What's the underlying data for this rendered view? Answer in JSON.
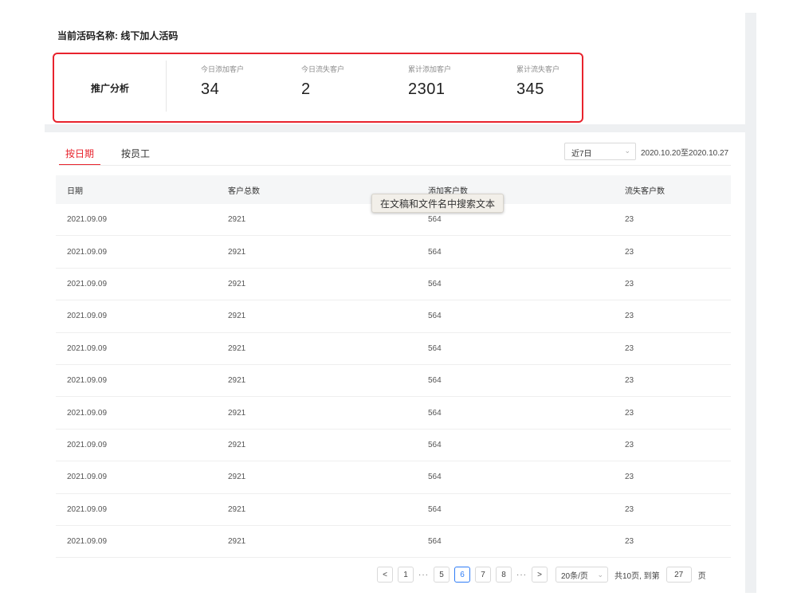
{
  "header": {
    "title": "当前活码名称: 线下加人活码"
  },
  "stats": {
    "section_label": "推广分析",
    "items": [
      {
        "label": "今日添加客户",
        "value": "34"
      },
      {
        "label": "今日流失客户",
        "value": "2"
      },
      {
        "label": "累计添加客户",
        "value": "2301"
      },
      {
        "label": "累计流失客户",
        "value": "345"
      }
    ]
  },
  "tabs": [
    {
      "label": "按日期",
      "active": true
    },
    {
      "label": "按员工",
      "active": false
    }
  ],
  "filter": {
    "period": "近7日",
    "date_range": "2020.10.20至2020.10.27"
  },
  "table": {
    "columns": [
      "日期",
      "客户总数",
      "添加客户数",
      "流失客户数"
    ],
    "rows": [
      [
        "2021.09.09",
        "2921",
        "564",
        "23"
      ],
      [
        "2021.09.09",
        "2921",
        "564",
        "23"
      ],
      [
        "2021.09.09",
        "2921",
        "564",
        "23"
      ],
      [
        "2021.09.09",
        "2921",
        "564",
        "23"
      ],
      [
        "2021.09.09",
        "2921",
        "564",
        "23"
      ],
      [
        "2021.09.09",
        "2921",
        "564",
        "23"
      ],
      [
        "2021.09.09",
        "2921",
        "564",
        "23"
      ],
      [
        "2021.09.09",
        "2921",
        "564",
        "23"
      ],
      [
        "2021.09.09",
        "2921",
        "564",
        "23"
      ],
      [
        "2021.09.09",
        "2921",
        "564",
        "23"
      ],
      [
        "2021.09.09",
        "2921",
        "564",
        "23"
      ]
    ]
  },
  "tooltip": "在文稿和文件名中搜索文本",
  "pagination": {
    "prev": "<",
    "next": ">",
    "pages": [
      "1",
      "5",
      "6",
      "7",
      "8"
    ],
    "current": "6",
    "ellipsis": "···",
    "page_size": "20条/页",
    "total_text": "共10页, 到第",
    "jump_value": "27",
    "page_suffix": "页"
  },
  "colors": {
    "accent": "#e8232d",
    "pagination_active": "#2f7cf6"
  }
}
